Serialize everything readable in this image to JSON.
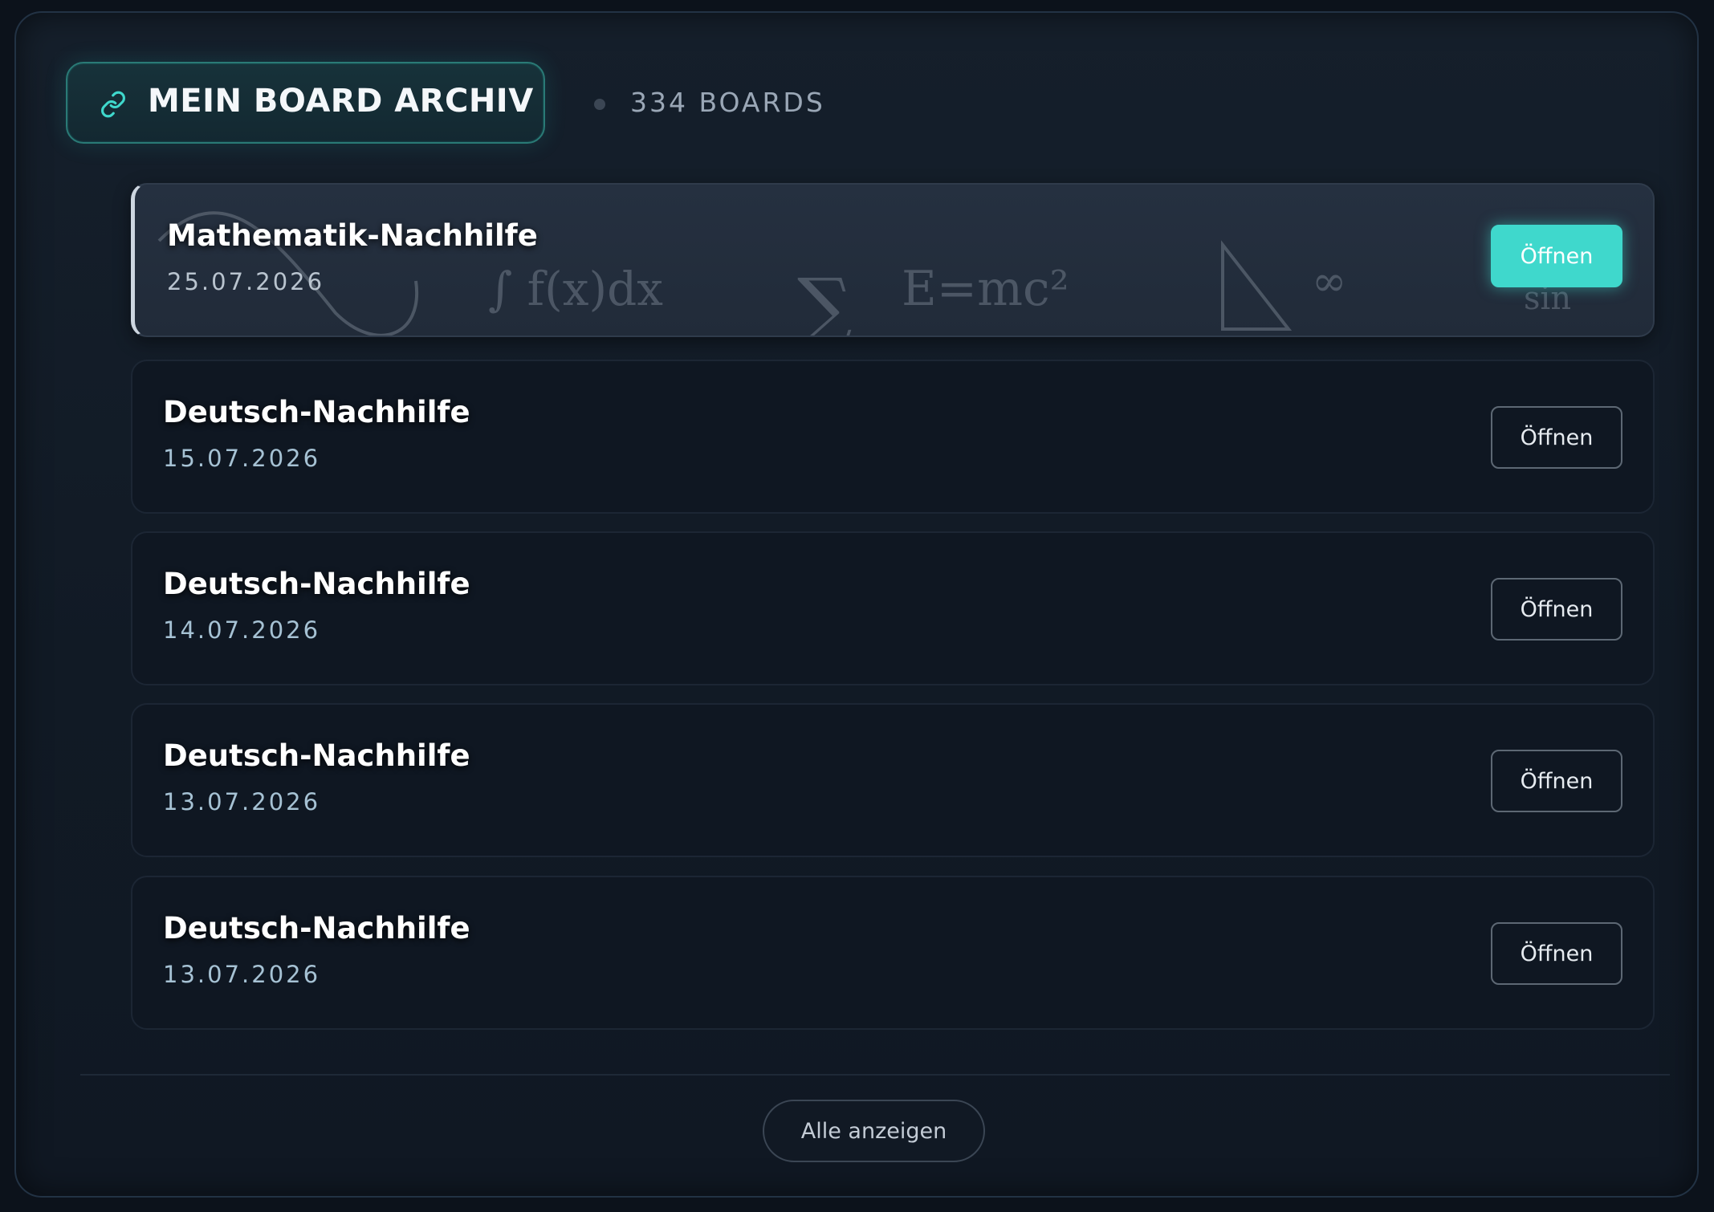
{
  "header": {
    "icon": "link-icon",
    "title": "MEIN BOARD ARCHIV",
    "count": "334 BOARDS"
  },
  "boards": [
    {
      "title": "Mathematik-Nachhilfe",
      "date": "25.07.2026",
      "button": "Öffnen",
      "active": true
    },
    {
      "title": "Deutsch-Nachhilfe",
      "date": "15.07.2026",
      "button": "Öffnen",
      "active": false
    },
    {
      "title": "Deutsch-Nachhilfe",
      "date": "14.07.2026",
      "button": "Öffnen",
      "active": false
    },
    {
      "title": "Deutsch-Nachhilfe",
      "date": "13.07.2026",
      "button": "Öffnen",
      "active": false
    },
    {
      "title": "Deutsch-Nachhilfe",
      "date": "13.07.2026",
      "button": "Öffnen",
      "active": false
    }
  ],
  "decoration": {
    "integral": "∫ f(x)dx",
    "sigma": "∑",
    "formula": "E=mc²",
    "infinity": "∞",
    "sin": "sin"
  },
  "footer": {
    "show_all": "Alle anzeigen"
  },
  "colors": {
    "accent": "#3fd8cc",
    "background": "#0c121b",
    "panel": "#131c27"
  }
}
